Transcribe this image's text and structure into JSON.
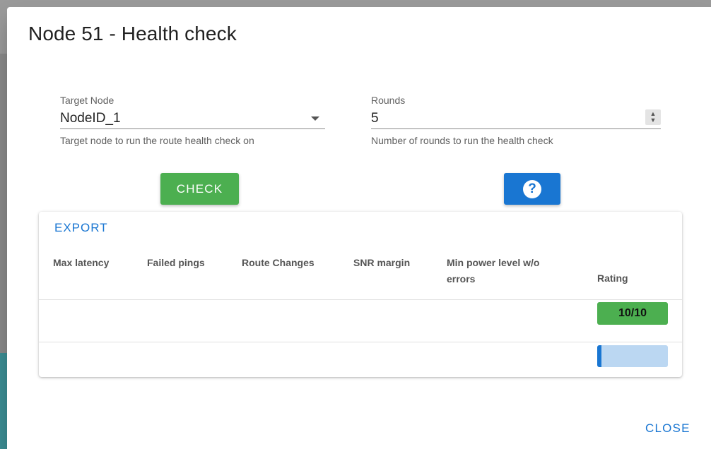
{
  "dialog": {
    "title": "Node 51 - Health check"
  },
  "form": {
    "target_node": {
      "label": "Target Node",
      "value": "NodeID_1",
      "hint": "Target node to run the route health check on"
    },
    "rounds": {
      "label": "Rounds",
      "value": "5",
      "hint": "Number of rounds to run the health check"
    }
  },
  "buttons": {
    "check_label": "CHECK",
    "help_glyph": "?",
    "export_label": "EXPORT",
    "close_label": "CLOSE"
  },
  "table": {
    "headers": [
      "Max latency",
      "Failed pings",
      "Route Changes",
      "SNR margin",
      "Min power level w/o errors",
      "Rating"
    ],
    "rows": [
      {
        "rating": "10/10"
      },
      {
        "progress": 0.06
      }
    ]
  },
  "colors": {
    "check_button": "#4caf50",
    "help_button": "#1976d2",
    "rating_badge": "#4caf50",
    "progress_track": "#bbd7f2",
    "progress_fill": "#1976d2"
  },
  "icons": {
    "help": "help-circle-icon",
    "dropdown": "dropdown-arrow-icon",
    "spinner": "spinner-updown-icon"
  }
}
